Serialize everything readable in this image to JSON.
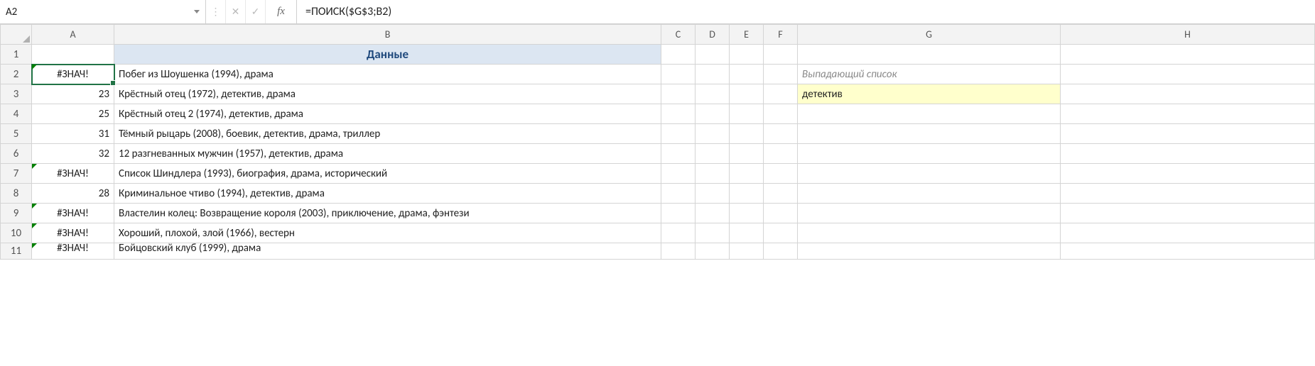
{
  "formulaBar": {
    "nameBox": "A2",
    "fxLabel": "fx",
    "formula": "=ПОИСК($G$3;B2)",
    "cancelGlyph": "✕",
    "enterGlyph": "✓"
  },
  "columns": {
    "A": "A",
    "B": "B",
    "C": "C",
    "D": "D",
    "E": "E",
    "F": "F",
    "G": "G",
    "H": "H"
  },
  "header": {
    "B1": "Данные"
  },
  "rows": [
    {
      "n": "1"
    },
    {
      "n": "2",
      "A": "#ЗНАЧ!",
      "Aerr": true,
      "B": "Побег из Шоушенка (1994), драма",
      "G": "Выпадающий список",
      "Gstyle": "italic"
    },
    {
      "n": "3",
      "A": "23",
      "Aerr": false,
      "B": "Крёстный отец (1972), детектив, драма",
      "G": "детектив",
      "Gstyle": "yellow"
    },
    {
      "n": "4",
      "A": "25",
      "Aerr": false,
      "B": "Крёстный отец 2 (1974), детектив, драма"
    },
    {
      "n": "5",
      "A": "31",
      "Aerr": false,
      "B": "Тёмный рыцарь (2008), боевик, детектив, драма, триллер"
    },
    {
      "n": "6",
      "A": "32",
      "Aerr": false,
      "B": "12 разгневанных мужчин (1957), детектив, драма"
    },
    {
      "n": "7",
      "A": "#ЗНАЧ!",
      "Aerr": true,
      "B": "Список Шиндлера (1993), биография, драма, исторический"
    },
    {
      "n": "8",
      "A": "28",
      "Aerr": false,
      "B": "Криминальное чтиво (1994), детектив, драма"
    },
    {
      "n": "9",
      "A": "#ЗНАЧ!",
      "Aerr": true,
      "B": "Властелин колец: Возвращение короля (2003), приключение, драма, фэнтези"
    },
    {
      "n": "10",
      "A": "#ЗНАЧ!",
      "Aerr": true,
      "B": "Хороший, плохой, злой (1966), вестерн"
    },
    {
      "n": "11",
      "A": "#ЗНАЧ!",
      "Aerr": true,
      "B": "Бойцовский клуб (1999), драма"
    }
  ]
}
